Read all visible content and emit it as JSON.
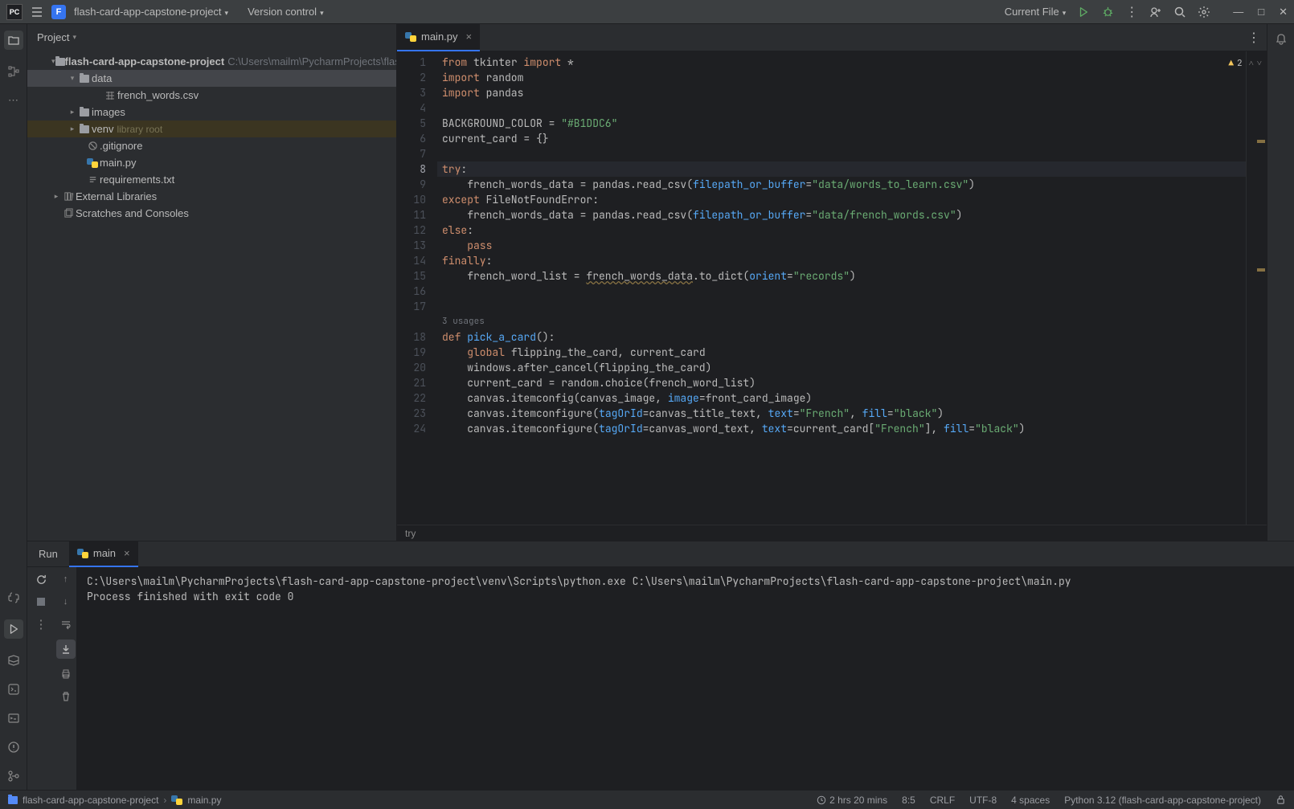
{
  "top": {
    "pc_badge": "PC",
    "project_badge": "F",
    "project_name": "flash-card-app-capstone-project",
    "version_control": "Version control",
    "current_file": "Current File"
  },
  "project_panel": {
    "title": "Project",
    "root": {
      "name": "flash-card-app-capstone-project",
      "path": "C:\\Users\\mailm\\PycharmProjects\\flash-card-app-capstone-project"
    },
    "data_folder": "data",
    "data_file": "french_words.csv",
    "images_folder": "images",
    "venv_folder": "venv",
    "venv_tag": "library root",
    "gitignore": ".gitignore",
    "mainpy": "main.py",
    "requirements": "requirements.txt",
    "external": "External Libraries",
    "scratches": "Scratches and Consoles"
  },
  "editor": {
    "tab_name": "main.py",
    "warnings_count": "2",
    "usages_hint": "3 usages",
    "breadcrumb": "try",
    "lines": [
      {
        "n": 1,
        "tokens": [
          {
            "t": "from ",
            "c": "k"
          },
          {
            "t": "tkinter ",
            "c": "p"
          },
          {
            "t": "import ",
            "c": "k"
          },
          {
            "t": "*",
            "c": "p"
          }
        ]
      },
      {
        "n": 2,
        "tokens": [
          {
            "t": "import ",
            "c": "k"
          },
          {
            "t": "random",
            "c": "p"
          }
        ]
      },
      {
        "n": 3,
        "tokens": [
          {
            "t": "import ",
            "c": "k"
          },
          {
            "t": "pandas",
            "c": "p"
          }
        ]
      },
      {
        "n": 4,
        "tokens": []
      },
      {
        "n": 5,
        "tokens": [
          {
            "t": "BACKGROUND_COLOR = ",
            "c": "p"
          },
          {
            "t": "\"#B1DDC6\"",
            "c": "s"
          }
        ]
      },
      {
        "n": 6,
        "tokens": [
          {
            "t": "current_card = {}",
            "c": "p"
          }
        ]
      },
      {
        "n": 7,
        "tokens": []
      },
      {
        "n": 8,
        "caret": true,
        "tokens": [
          {
            "t": "try",
            "c": "k"
          },
          {
            "t": ":",
            "c": "p"
          }
        ]
      },
      {
        "n": 9,
        "tokens": [
          {
            "t": "    french_words_data = pandas.read_csv(",
            "c": "p"
          },
          {
            "t": "filepath_or_buffer",
            "c": "pa"
          },
          {
            "t": "=",
            "c": "p"
          },
          {
            "t": "\"data/words_to_learn.csv\"",
            "c": "s"
          },
          {
            "t": ")",
            "c": "p"
          }
        ]
      },
      {
        "n": 10,
        "tokens": [
          {
            "t": "except ",
            "c": "k"
          },
          {
            "t": "FileNotFoundError",
            "c": "p"
          },
          {
            "t": ":",
            "c": "p"
          }
        ]
      },
      {
        "n": 11,
        "tokens": [
          {
            "t": "    french_words_data = pandas.read_csv(",
            "c": "p"
          },
          {
            "t": "filepath_or_buffer",
            "c": "pa"
          },
          {
            "t": "=",
            "c": "p"
          },
          {
            "t": "\"data/french_words.csv\"",
            "c": "s"
          },
          {
            "t": ")",
            "c": "p"
          }
        ]
      },
      {
        "n": 12,
        "tokens": [
          {
            "t": "else",
            "c": "k"
          },
          {
            "t": ":",
            "c": "p"
          }
        ]
      },
      {
        "n": 13,
        "tokens": [
          {
            "t": "    ",
            "c": "p"
          },
          {
            "t": "pass",
            "c": "k"
          }
        ]
      },
      {
        "n": 14,
        "tokens": [
          {
            "t": "finally",
            "c": "k"
          },
          {
            "t": ":",
            "c": "p"
          }
        ]
      },
      {
        "n": 15,
        "tokens": [
          {
            "t": "    french_word_list = ",
            "c": "p"
          },
          {
            "t": "french_words_data",
            "c": "p uw"
          },
          {
            "t": ".to_dict(",
            "c": "p"
          },
          {
            "t": "orient",
            "c": "pa"
          },
          {
            "t": "=",
            "c": "p"
          },
          {
            "t": "\"records\"",
            "c": "s"
          },
          {
            "t": ")",
            "c": "p"
          }
        ]
      },
      {
        "n": 16,
        "tokens": []
      },
      {
        "n": 17,
        "tokens": []
      },
      {
        "n": 18,
        "usages": true,
        "tokens": [
          {
            "t": "def ",
            "c": "k"
          },
          {
            "t": "pick_a_card",
            "c": "def"
          },
          {
            "t": "():",
            "c": "p"
          }
        ]
      },
      {
        "n": 19,
        "tokens": [
          {
            "t": "    ",
            "c": "p"
          },
          {
            "t": "global ",
            "c": "k"
          },
          {
            "t": "flipping_the_card, current_card",
            "c": "p"
          }
        ]
      },
      {
        "n": 20,
        "tokens": [
          {
            "t": "    windows.after_cancel(flipping_the_card)",
            "c": "p"
          }
        ]
      },
      {
        "n": 21,
        "tokens": [
          {
            "t": "    current_card = random.choice(french_word_list)",
            "c": "p"
          }
        ]
      },
      {
        "n": 22,
        "tokens": [
          {
            "t": "    canvas.itemconfig(canvas_image, ",
            "c": "p"
          },
          {
            "t": "image",
            "c": "pa"
          },
          {
            "t": "=front_card_image)",
            "c": "p"
          }
        ]
      },
      {
        "n": 23,
        "tokens": [
          {
            "t": "    canvas.itemconfigure(",
            "c": "p"
          },
          {
            "t": "tagOrId",
            "c": "pa"
          },
          {
            "t": "=canvas_title_text, ",
            "c": "p"
          },
          {
            "t": "text",
            "c": "pa"
          },
          {
            "t": "=",
            "c": "p"
          },
          {
            "t": "\"French\"",
            "c": "s"
          },
          {
            "t": ", ",
            "c": "p"
          },
          {
            "t": "fill",
            "c": "pa"
          },
          {
            "t": "=",
            "c": "p"
          },
          {
            "t": "\"black\"",
            "c": "s"
          },
          {
            "t": ")",
            "c": "p"
          }
        ]
      },
      {
        "n": 24,
        "tokens": [
          {
            "t": "    canvas.itemconfigure(",
            "c": "p"
          },
          {
            "t": "tagOrId",
            "c": "pa"
          },
          {
            "t": "=canvas_word_text, ",
            "c": "p"
          },
          {
            "t": "text",
            "c": "pa"
          },
          {
            "t": "=current_card[",
            "c": "p"
          },
          {
            "t": "\"French\"",
            "c": "s"
          },
          {
            "t": "], ",
            "c": "p"
          },
          {
            "t": "fill",
            "c": "pa"
          },
          {
            "t": "=",
            "c": "p"
          },
          {
            "t": "\"black\"",
            "c": "s"
          },
          {
            "t": ")",
            "c": "p"
          }
        ]
      }
    ]
  },
  "run": {
    "title": "Run",
    "tab": "main",
    "output_line1": "C:\\Users\\mailm\\PycharmProjects\\flash-card-app-capstone-project\\venv\\Scripts\\python.exe C:\\Users\\mailm\\PycharmProjects\\flash-card-app-capstone-project\\main.py",
    "output_line2": "",
    "output_line3": "Process finished with exit code 0"
  },
  "status": {
    "crumb1": "flash-card-app-capstone-project",
    "crumb2": "main.py",
    "time": "2 hrs 20 mins",
    "pos": "8:5",
    "eol": "CRLF",
    "enc": "UTF-8",
    "indent": "4 spaces",
    "interpreter": "Python 3.12 (flash-card-app-capstone-project)"
  }
}
